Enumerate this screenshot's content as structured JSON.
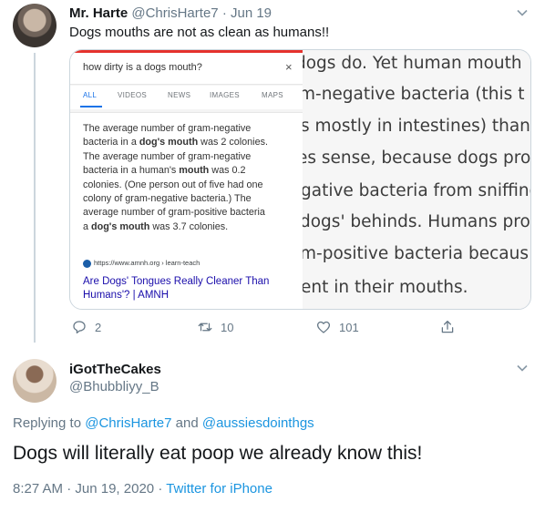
{
  "tweet1": {
    "name": "Mr. Harte",
    "handle": "@ChrisHarte7",
    "separator": "·",
    "date": "Jun 19",
    "text": "Dogs mouths are not as clean as humans!!",
    "media": {
      "search_query": "how dirty is a dogs mouth?",
      "close_glyph": "×",
      "tabs": [
        "ALL",
        "VIDEOS",
        "NEWS",
        "IMAGES",
        "MAPS"
      ],
      "snippet": {
        "l1": "The average number of gram-negative",
        "l2_pre": "bacteria in a ",
        "l2_bold": "dog's mouth",
        "l2_post": " was 2 colonies.",
        "l3": "The average number of gram-negative",
        "l4_pre": "bacteria in a human's ",
        "l4_bold": "mouth",
        "l4_post": " was 0.2",
        "l5": "colonies. (One person out of five had one",
        "l6": "colony of gram-negative bacteria.) The",
        "l7": "average number of gram-positive bacteria",
        "l8_pre": "a ",
        "l8_bold": "dog's mouth",
        "l8_post": " was 3.7 colonies."
      },
      "source_url": "https://www.amnh.org › learn-teach",
      "result_link": "Are Dogs' Tongues Really Cleaner Than Humans'? | AMNH",
      "zoomed_lines": [
        "dogs do. Yet human mouth",
        "m-negative bacteria (this t",
        "s mostly in intestines) than",
        "es sense, because dogs pro",
        "gative bacteria from sniffing",
        "dogs' behinds. Humans pro",
        "m-positive bacteria becaus",
        "ent in their mouths."
      ]
    },
    "actions": {
      "replies": "2",
      "retweets": "10",
      "likes": "101"
    }
  },
  "tweet2": {
    "name": "iGotTheCakes",
    "handle": "@Bhubbliyy_B",
    "replying_label": "Replying to",
    "reply_mention_1": "@ChrisHarte7",
    "reply_and": "and",
    "reply_mention_2": "@aussiesdointhgs",
    "text": "Dogs will literally eat poop we already know this!",
    "time": "8:27 AM",
    "date": "Jun 19, 2020",
    "separator": "·",
    "source": "Twitter for iPhone"
  },
  "icons": {
    "reply": "reply-icon",
    "retweet": "retweet-icon",
    "like": "heart-icon",
    "share": "share-icon",
    "more": "chevron-down-icon"
  },
  "colors": {
    "link_blue": "#1b95e0",
    "muted_gray": "#657786",
    "search_red_bar": "#e5322d",
    "google_link": "#1a0dab"
  }
}
